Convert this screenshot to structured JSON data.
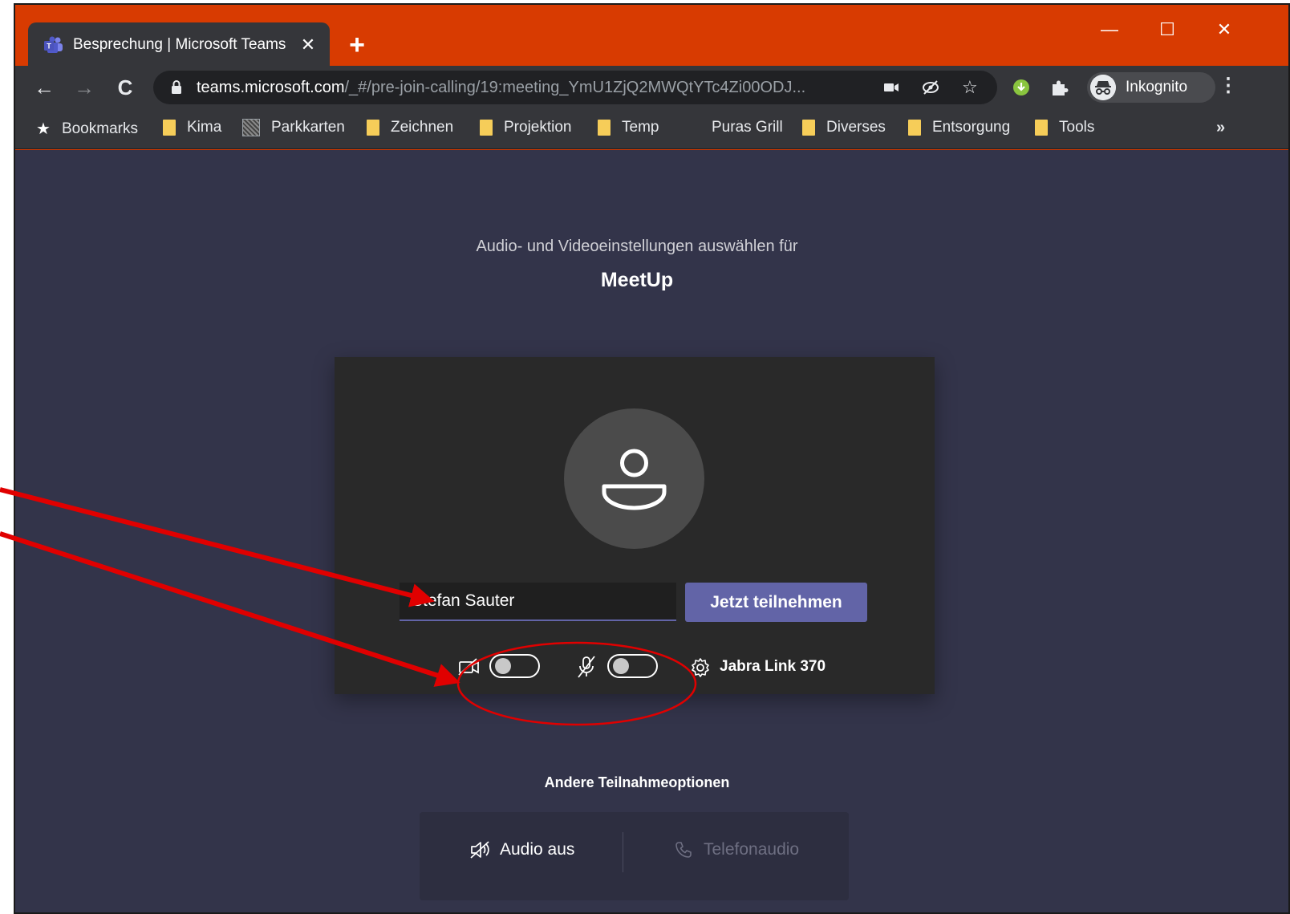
{
  "browser": {
    "tab_title": "Besprechung | Microsoft Teams",
    "tab_close": "✕",
    "new_tab": "+",
    "window_controls": {
      "minimize": "—",
      "maximize": "☐",
      "close": "✕"
    },
    "url_host": "teams.microsoft.com",
    "url_path": "/_#/pre-join-calling/19:meeting_YmU1ZjQ2MWQtYTc4Zi00ODJ...",
    "profile_label": "Inkognito",
    "nav": {
      "back": "←",
      "forward": "→",
      "reload": "C"
    },
    "bookmarks": [
      {
        "label": "Bookmarks",
        "icon": "star-icon"
      },
      {
        "label": "Kima",
        "icon": "folder-icon"
      },
      {
        "label": "Parkkarten",
        "icon": "image-icon"
      },
      {
        "label": "Zeichnen",
        "icon": "folder-icon"
      },
      {
        "label": "Projektion",
        "icon": "folder-icon"
      },
      {
        "label": "Temp",
        "icon": "folder-icon"
      },
      {
        "label": "Puras Grill",
        "icon": "none"
      },
      {
        "label": "Diverses",
        "icon": "folder-icon"
      },
      {
        "label": "Entsorgung",
        "icon": "folder-icon"
      },
      {
        "label": "Tools",
        "icon": "folder-icon"
      }
    ],
    "bookmarks_more": "»"
  },
  "prejoin": {
    "subtitle": "Audio- und Videoeinstellungen auswählen für",
    "meeting_name": "MeetUp",
    "name_value": "Stefan Sauter",
    "join_label": "Jetzt teilnehmen",
    "camera_on": false,
    "mic_on": false,
    "device_label": "Jabra Link 370"
  },
  "other_options": {
    "title": "Andere Teilnahmeoptionen",
    "audio_off": "Audio aus",
    "phone_audio": "Telefonaudio"
  },
  "colors": {
    "browser_frame": "#d83b01",
    "teams_accent": "#6264a7",
    "content_bg": "#33344a",
    "annotation": "#e00000"
  }
}
